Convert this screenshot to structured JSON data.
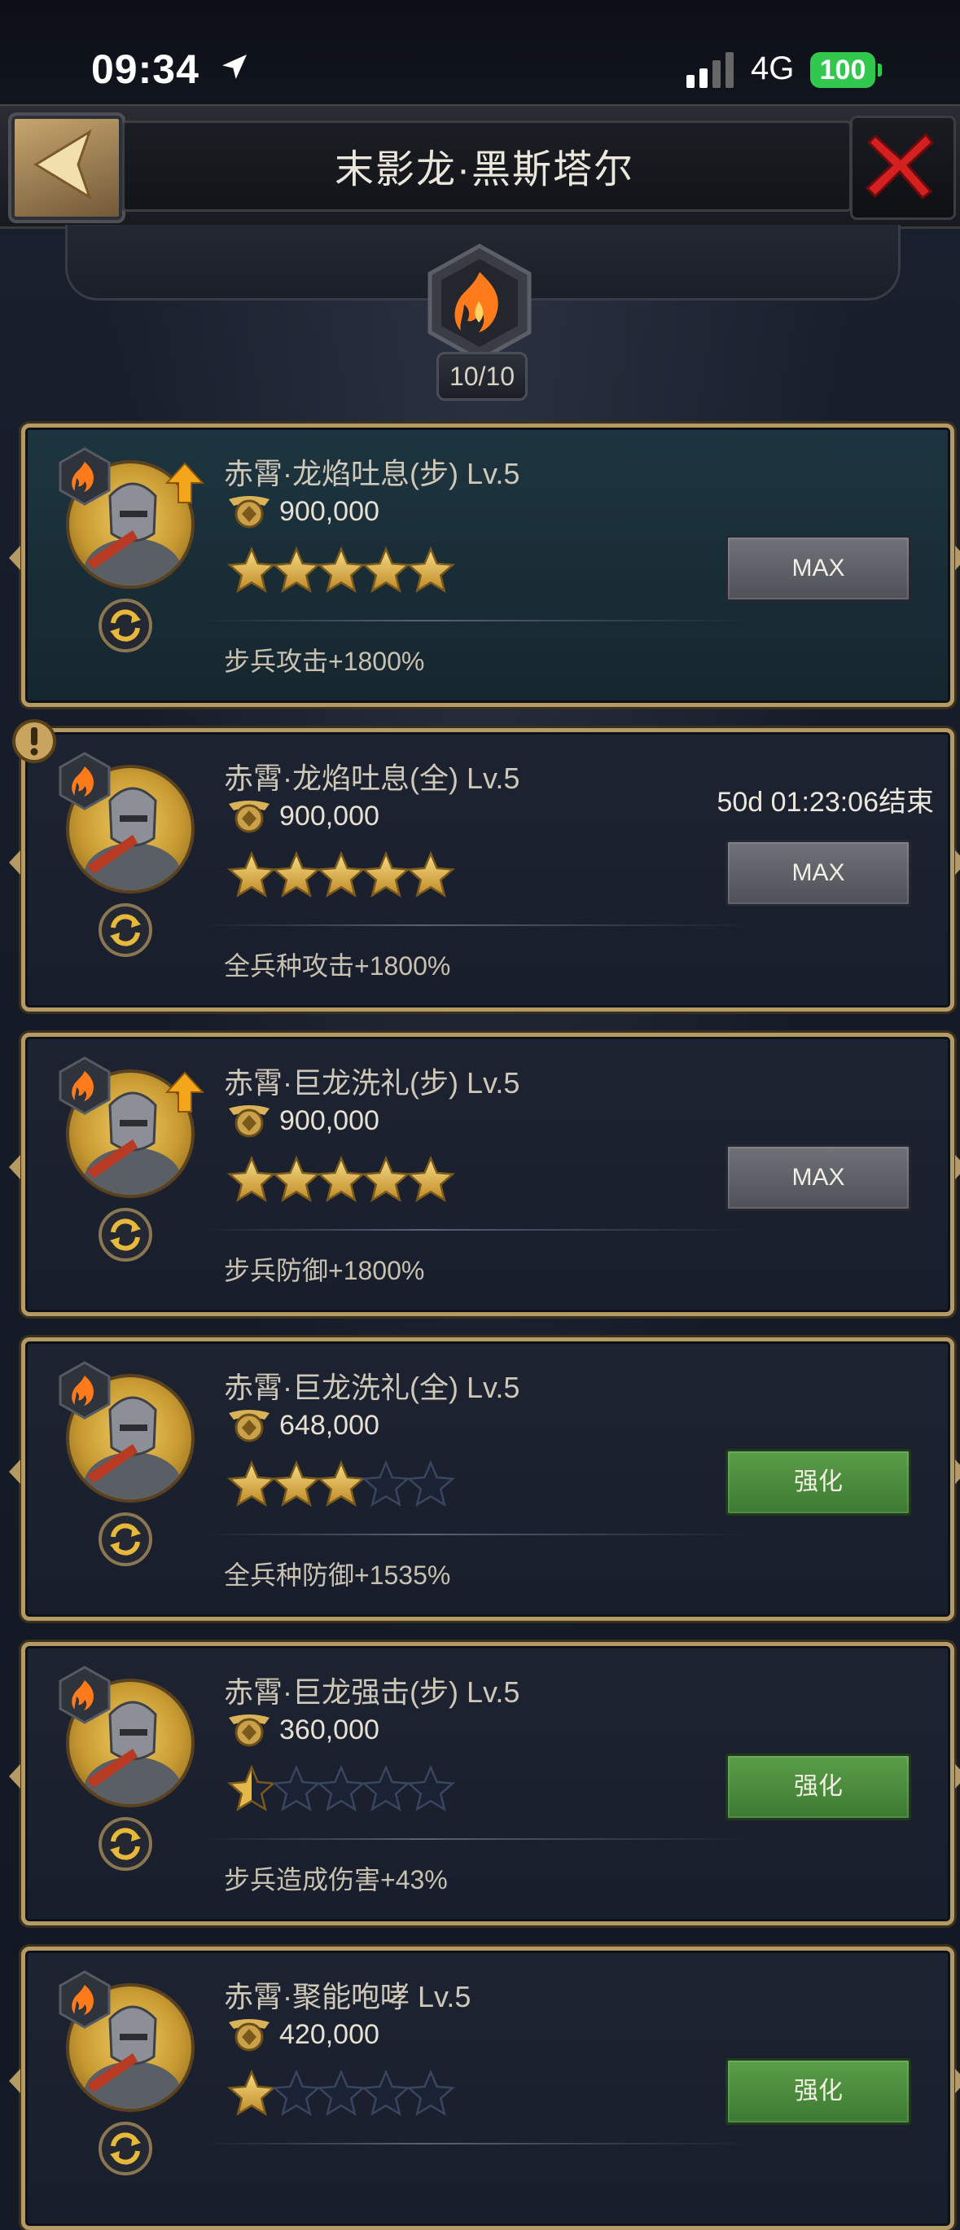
{
  "status_bar": {
    "time": "09:34",
    "network": "4G",
    "battery": "100"
  },
  "header": {
    "title": "末影龙·黑斯塔尔"
  },
  "progress": {
    "counter": "10/10"
  },
  "skills": [
    {
      "name": "赤霄·龙焰吐息(步) Lv.5",
      "power": "900,000",
      "stars": 5,
      "bonus": "步兵攻击+1800%",
      "button": "MAX",
      "timer": ""
    },
    {
      "name": "赤霄·龙焰吐息(全) Lv.5",
      "power": "900,000",
      "stars": 5,
      "bonus": "全兵种攻击+1800%",
      "button": "MAX",
      "timer": "50d 01:23:06结束"
    },
    {
      "name": "赤霄·巨龙洗礼(步) Lv.5",
      "power": "900,000",
      "stars": 5,
      "bonus": "步兵防御+1800%",
      "button": "MAX",
      "timer": ""
    },
    {
      "name": "赤霄·巨龙洗礼(全) Lv.5",
      "power": "648,000",
      "stars": 3,
      "bonus": "全兵种防御+1535%",
      "button": "强化",
      "timer": ""
    },
    {
      "name": "赤霄·巨龙强击(步) Lv.5",
      "power": "360,000",
      "stars": 0.5,
      "bonus": "步兵造成伤害+43%",
      "button": "强化",
      "timer": ""
    },
    {
      "name": "赤霄·聚能咆哮 Lv.5",
      "power": "420,000",
      "stars": 1,
      "bonus": "",
      "button": "强化",
      "timer": ""
    }
  ],
  "colors": {
    "gold": "#b59a64",
    "enhance_green": "#4b8c3e",
    "max_gray": "#5e6167",
    "star_gold": "#e2b84a"
  }
}
